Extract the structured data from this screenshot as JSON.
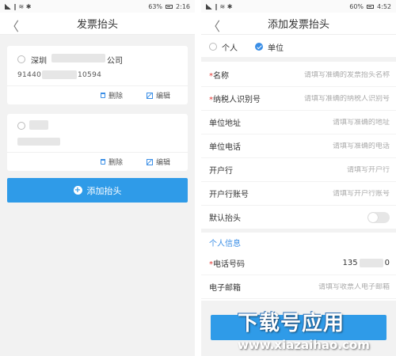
{
  "left_screen": {
    "status": {
      "icons": "∥ ≋ ✱",
      "battery": "63%",
      "time": "2:16"
    },
    "nav_title": "发票抬头",
    "back_glyph": "〈",
    "cards": [
      {
        "company_prefix": "深圳",
        "company_suffix": "公司",
        "tax_prefix": "91440",
        "tax_suffix": "10594",
        "delete": "删除",
        "edit": "编辑"
      },
      {
        "delete": "删除",
        "edit": "编辑"
      }
    ],
    "add_button": "添加抬头"
  },
  "right_screen": {
    "status": {
      "icons": "∥ ≋ ✱",
      "battery": "60%",
      "time": "4:52"
    },
    "nav_title": "添加发票抬头",
    "back_glyph": "〈",
    "type_options": [
      {
        "label": "个人",
        "checked": false
      },
      {
        "label": "单位",
        "checked": true
      }
    ],
    "fields": [
      {
        "label": "名称",
        "required": "*",
        "placeholder": "请填写准确的发票抬头名称"
      },
      {
        "label": "纳税人识别号",
        "required": "*",
        "placeholder": "请填写准确的纳税人识别号"
      },
      {
        "label": "单位地址",
        "placeholder": "请填写准确的地址"
      },
      {
        "label": "单位电话",
        "placeholder": "请填写准确的电话"
      },
      {
        "label": "开户行",
        "placeholder": "请填写开户行"
      },
      {
        "label": "开户行账号",
        "placeholder": "请填写开户行账号"
      }
    ],
    "default_label": "默认抬头",
    "default_on": false,
    "section_personal": "个人信息",
    "phone": {
      "label": "电话号码",
      "required": "*",
      "value_prefix": "135",
      "value_suffix": "0"
    },
    "email": {
      "label": "电子邮箱",
      "placeholder": "请填写收票人电子邮箱"
    }
  },
  "watermark": {
    "main": "下载号应用",
    "url": "www.xiazaihao.com"
  },
  "colors": {
    "accent": "#2f9be8",
    "required": "#e53935",
    "background": "#f2f2f2"
  }
}
